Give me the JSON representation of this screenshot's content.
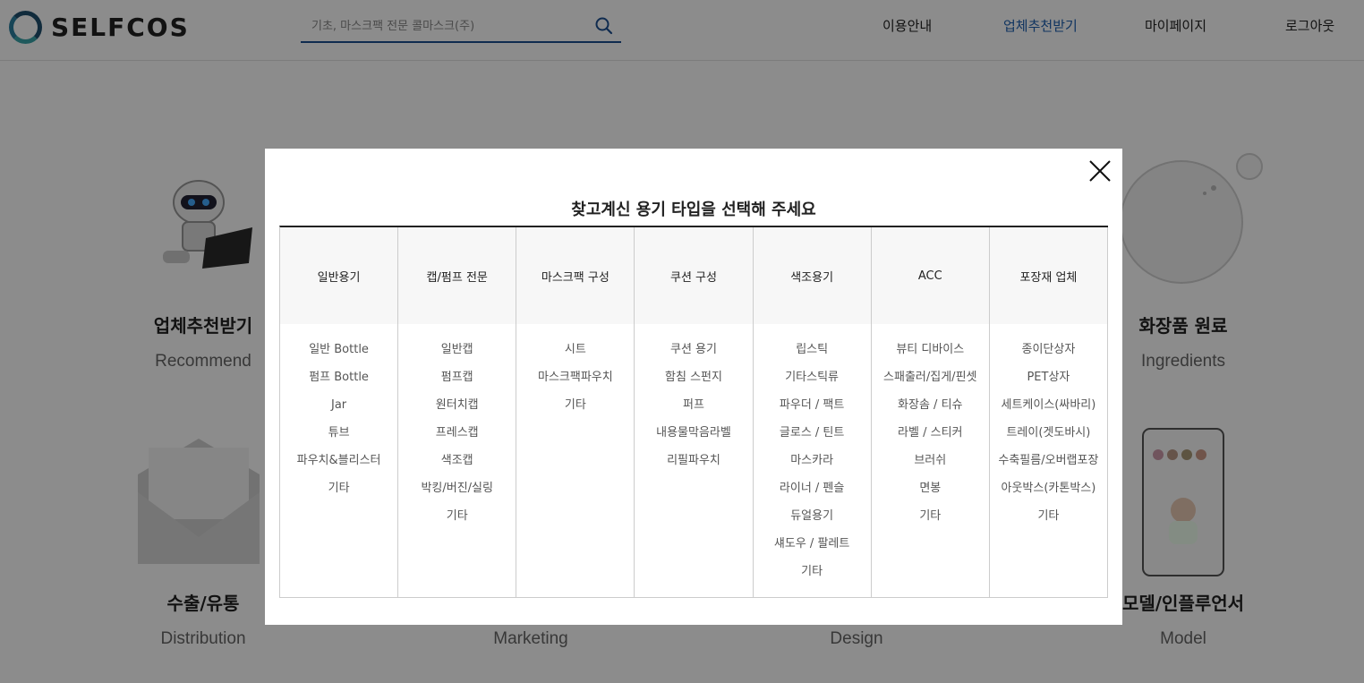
{
  "brand": {
    "name": "SELFCOS"
  },
  "search": {
    "placeholder": "기초, 마스크팩 전문 콜마스크(주)"
  },
  "nav": [
    "이용안내",
    "업체추천받기",
    "마이페이지",
    "로그아웃"
  ],
  "nav_active": "업체추천받기",
  "background": {
    "cards": [
      {
        "title": "업체추천받기",
        "subtitle": "Recommend"
      },
      {
        "title": "화장품 원료",
        "subtitle": "Ingredients"
      },
      {
        "title": "수출/유통",
        "subtitle": "Distribution"
      },
      {
        "title": "",
        "subtitle": "Marketing"
      },
      {
        "title": "",
        "subtitle": "Design"
      },
      {
        "title": "모델/인플루언서",
        "subtitle": "Model"
      }
    ]
  },
  "modal": {
    "title": "찾고계신 용기 타입을 선택해 주세요",
    "columns": [
      {
        "header": "일반용기",
        "items": [
          "일반 Bottle",
          "펌프 Bottle",
          "Jar",
          "튜브",
          "파우치&블리스터",
          "기타"
        ]
      },
      {
        "header": "캡/펌프 전문",
        "items": [
          "일반캡",
          "펌프캡",
          "원터치캡",
          "프레스캡",
          "색조캡",
          "박킹/버진/실링",
          "기타"
        ]
      },
      {
        "header": "마스크팩 구성",
        "items": [
          "시트",
          "마스크팩파우치",
          "기타"
        ]
      },
      {
        "header": "쿠션 구성",
        "items": [
          "쿠션 용기",
          "함침 스펀지",
          "퍼프",
          "내용물막음라벨",
          "리필파우치"
        ]
      },
      {
        "header": "색조용기",
        "items": [
          "립스틱",
          "기타스틱류",
          "파우더 / 팩트",
          "글로스 / 틴트",
          "마스카라",
          "라이너 / 펜슬",
          "듀얼용기",
          "섀도우 / 팔레트",
          "기타"
        ]
      },
      {
        "header": "ACC",
        "items": [
          "뷰티 디바이스",
          "스패출러/집게/핀셋",
          "화장솜 / 티슈",
          "라벨 / 스티커",
          "브러쉬",
          "면봉",
          "기타"
        ]
      },
      {
        "header": "포장재 업체",
        "items": [
          "종이단상자",
          "PET상자",
          "세트케이스(싸바리)",
          "트레이(겟도바시)",
          "수축필름/오버랩포장",
          "아웃박스(카톤박스)",
          "기타"
        ]
      }
    ]
  }
}
